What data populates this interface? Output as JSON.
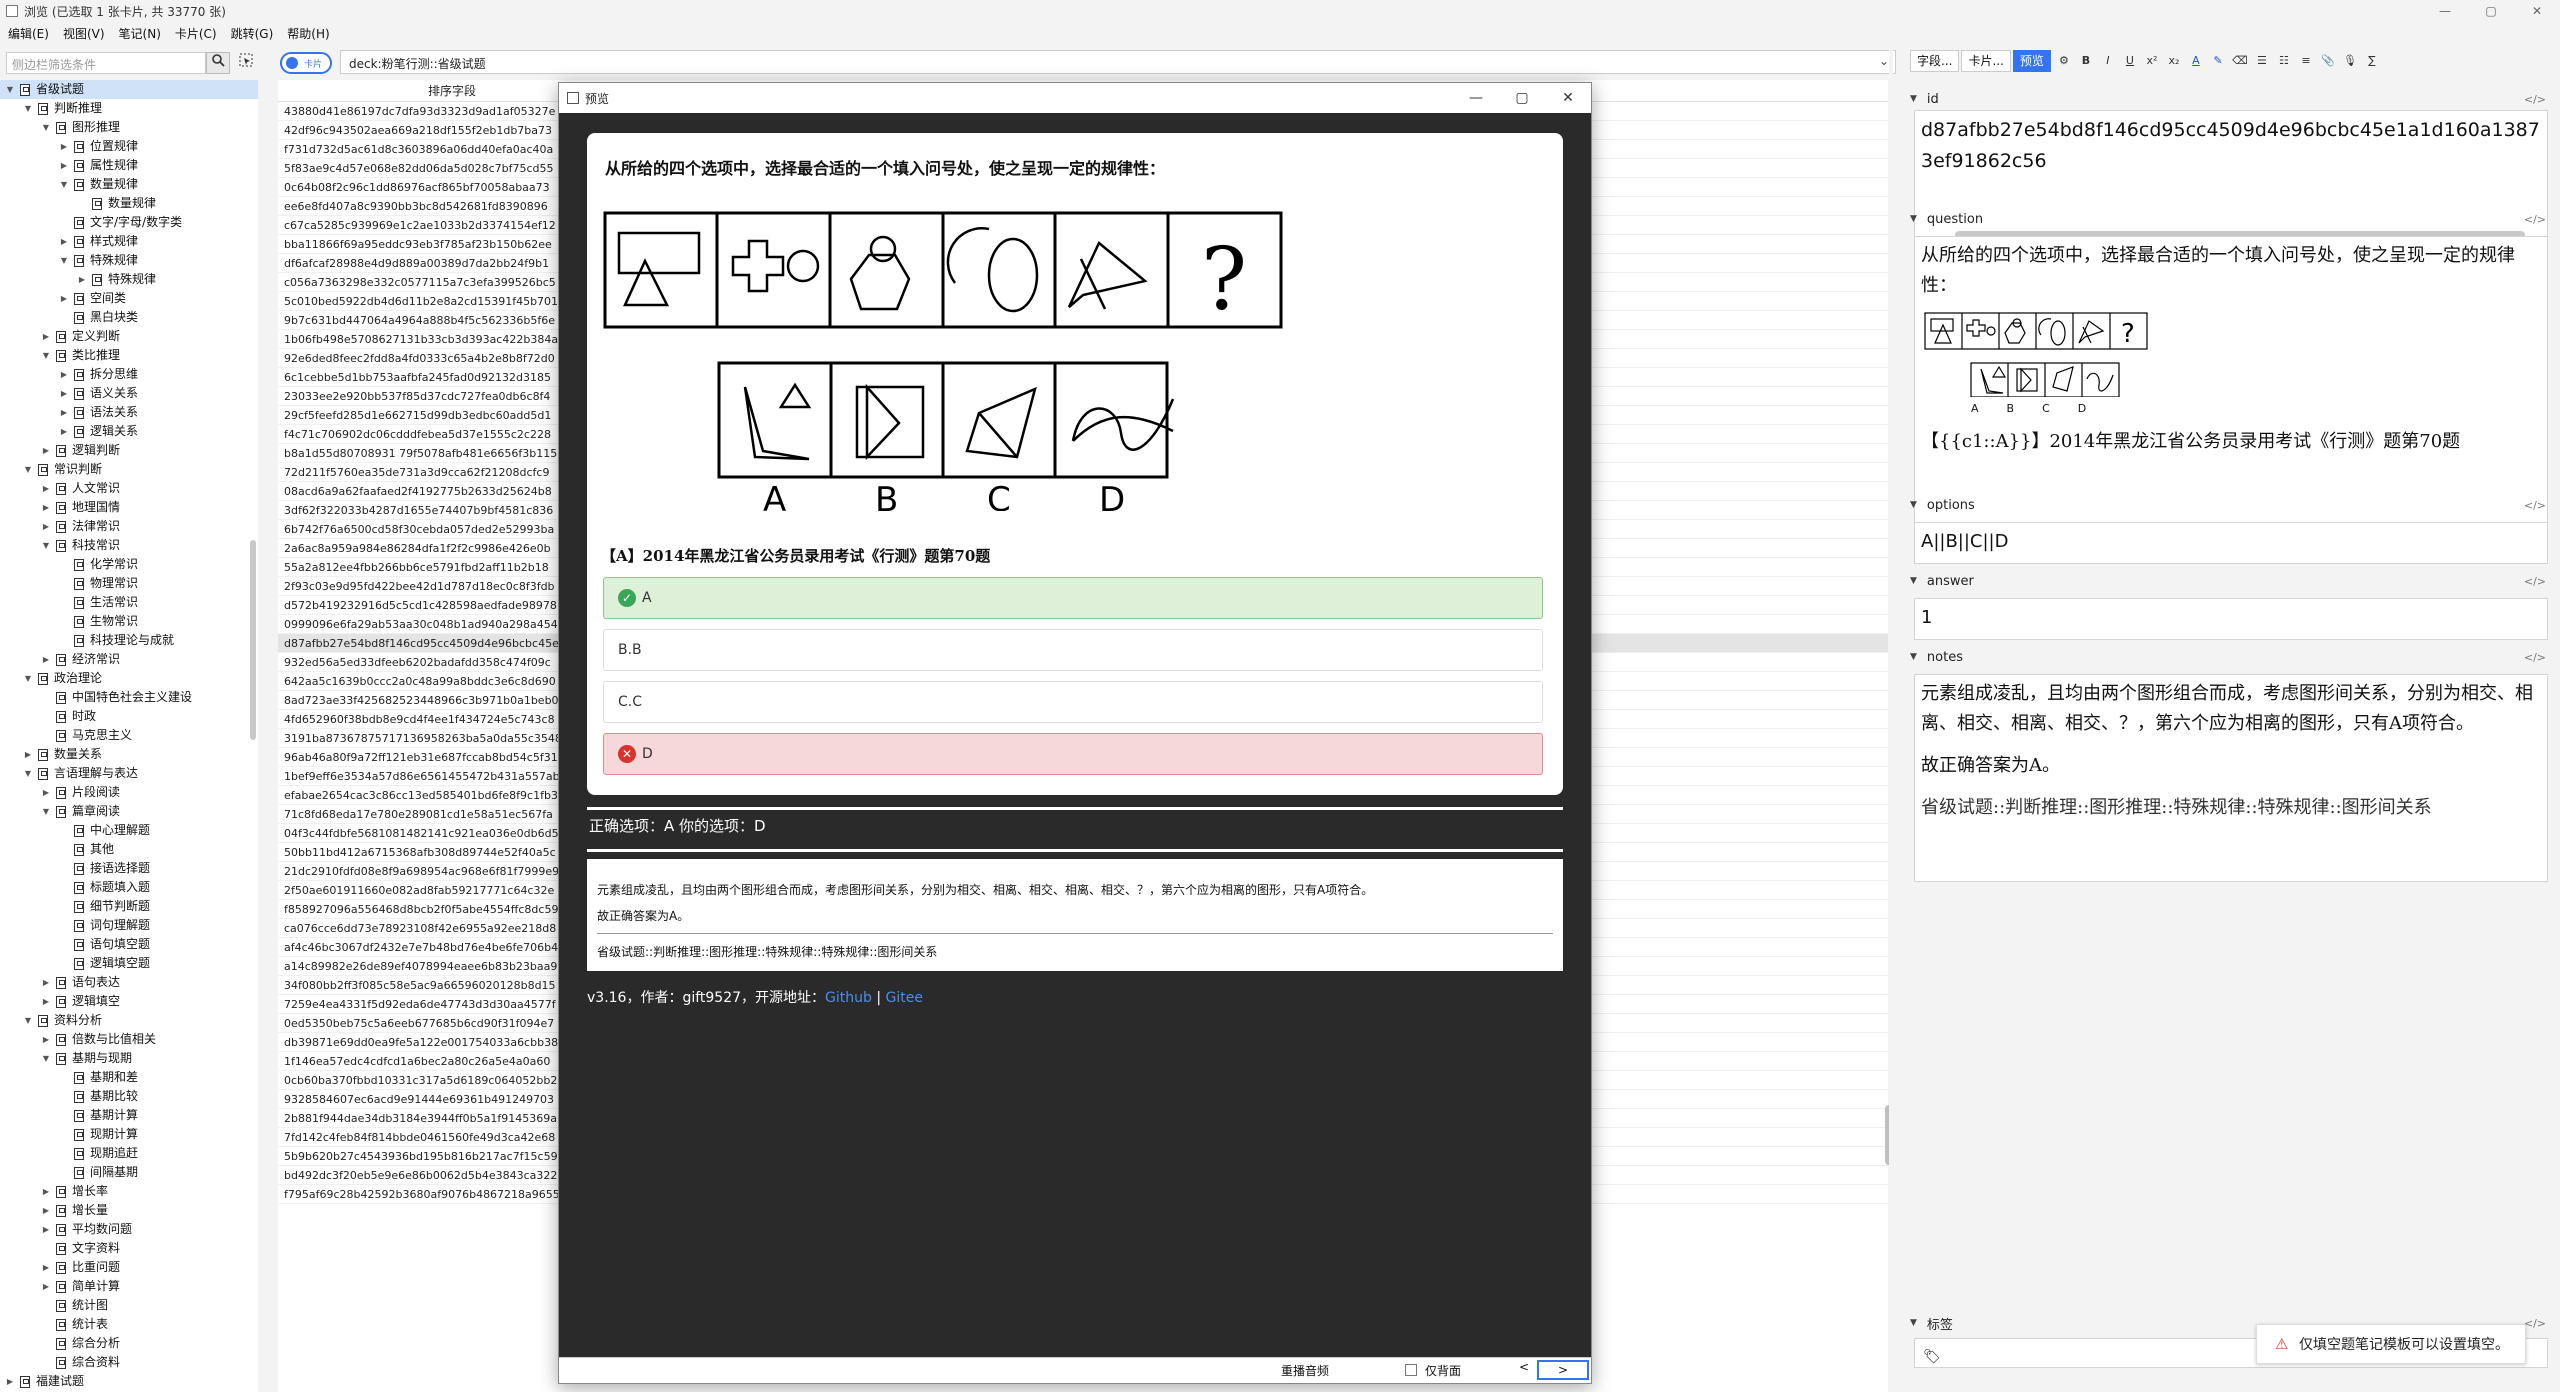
{
  "window": {
    "title": "浏览 (已选取 1 张卡片, 共 33770 张)",
    "controls": [
      "—",
      "▢",
      "✕"
    ]
  },
  "menu": [
    "编辑(E)",
    "视图(V)",
    "笔记(N)",
    "卡片(C)",
    "跳转(G)",
    "帮助(H)"
  ],
  "sidebar": {
    "search_placeholder": "侧边栏筛选条件",
    "tree": [
      {
        "label": "省级试题",
        "lvl": 1,
        "exp": true,
        "sel": true
      },
      {
        "label": "判断推理",
        "lvl": 2,
        "exp": true
      },
      {
        "label": "图形推理",
        "lvl": 3,
        "exp": true
      },
      {
        "label": "位置规律",
        "lvl": 4,
        "exp": false
      },
      {
        "label": "属性规律",
        "lvl": 4,
        "exp": false
      },
      {
        "label": "数量规律",
        "lvl": 4,
        "exp": true
      },
      {
        "label": "数量规律",
        "lvl": 5,
        "exp": null
      },
      {
        "label": "文字/字母/数字类",
        "lvl": 4,
        "exp": null
      },
      {
        "label": "样式规律",
        "lvl": 4,
        "exp": false
      },
      {
        "label": "特殊规律",
        "lvl": 4,
        "exp": true
      },
      {
        "label": "特殊规律",
        "lvl": 5,
        "exp": false
      },
      {
        "label": "空间类",
        "lvl": 4,
        "exp": false
      },
      {
        "label": "黑白块类",
        "lvl": 4,
        "exp": null
      },
      {
        "label": "定义判断",
        "lvl": 3,
        "exp": false
      },
      {
        "label": "类比推理",
        "lvl": 3,
        "exp": true
      },
      {
        "label": "拆分思维",
        "lvl": 4,
        "exp": false
      },
      {
        "label": "语义关系",
        "lvl": 4,
        "exp": false
      },
      {
        "label": "语法关系",
        "lvl": 4,
        "exp": false
      },
      {
        "label": "逻辑关系",
        "lvl": 4,
        "exp": false
      },
      {
        "label": "逻辑判断",
        "lvl": 3,
        "exp": false
      },
      {
        "label": "常识判断",
        "lvl": 2,
        "exp": true
      },
      {
        "label": "人文常识",
        "lvl": 3,
        "exp": false
      },
      {
        "label": "地理国情",
        "lvl": 3,
        "exp": false
      },
      {
        "label": "法律常识",
        "lvl": 3,
        "exp": false
      },
      {
        "label": "科技常识",
        "lvl": 3,
        "exp": true
      },
      {
        "label": "化学常识",
        "lvl": 4,
        "exp": null
      },
      {
        "label": "物理常识",
        "lvl": 4,
        "exp": null
      },
      {
        "label": "生活常识",
        "lvl": 4,
        "exp": null
      },
      {
        "label": "生物常识",
        "lvl": 4,
        "exp": null
      },
      {
        "label": "科技理论与成就",
        "lvl": 4,
        "exp": null
      },
      {
        "label": "经济常识",
        "lvl": 3,
        "exp": false
      },
      {
        "label": "政治理论",
        "lvl": 2,
        "exp": true
      },
      {
        "label": "中国特色社会主义建设",
        "lvl": 3,
        "exp": null
      },
      {
        "label": "时政",
        "lvl": 3,
        "exp": null
      },
      {
        "label": "马克思主义",
        "lvl": 3,
        "exp": null
      },
      {
        "label": "数量关系",
        "lvl": 2,
        "exp": false
      },
      {
        "label": "言语理解与表达",
        "lvl": 2,
        "exp": true
      },
      {
        "label": "片段阅读",
        "lvl": 3,
        "exp": false
      },
      {
        "label": "篇章阅读",
        "lvl": 3,
        "exp": true
      },
      {
        "label": "中心理解题",
        "lvl": 4,
        "exp": null
      },
      {
        "label": "其他",
        "lvl": 4,
        "exp": null
      },
      {
        "label": "接语选择题",
        "lvl": 4,
        "exp": null
      },
      {
        "label": "标题填入题",
        "lvl": 4,
        "exp": null
      },
      {
        "label": "细节判断题",
        "lvl": 4,
        "exp": null
      },
      {
        "label": "词句理解题",
        "lvl": 4,
        "exp": null
      },
      {
        "label": "语句填空题",
        "lvl": 4,
        "exp": null
      },
      {
        "label": "逻辑填空题",
        "lvl": 4,
        "exp": null
      },
      {
        "label": "语句表达",
        "lvl": 3,
        "exp": false
      },
      {
        "label": "逻辑填空",
        "lvl": 3,
        "exp": false
      },
      {
        "label": "资料分析",
        "lvl": 2,
        "exp": true
      },
      {
        "label": "倍数与比值相关",
        "lvl": 3,
        "exp": false
      },
      {
        "label": "基期与现期",
        "lvl": 3,
        "exp": true
      },
      {
        "label": "基期和差",
        "lvl": 4,
        "exp": null
      },
      {
        "label": "基期比较",
        "lvl": 4,
        "exp": null
      },
      {
        "label": "基期计算",
        "lvl": 4,
        "exp": null
      },
      {
        "label": "现期计算",
        "lvl": 4,
        "exp": null
      },
      {
        "label": "现期追赶",
        "lvl": 4,
        "exp": null
      },
      {
        "label": "间隔基期",
        "lvl": 4,
        "exp": null
      },
      {
        "label": "增长率",
        "lvl": 3,
        "exp": false
      },
      {
        "label": "增长量",
        "lvl": 3,
        "exp": false
      },
      {
        "label": "平均数问题",
        "lvl": 3,
        "exp": false
      },
      {
        "label": "文字资料",
        "lvl": 3,
        "exp": null
      },
      {
        "label": "比重问题",
        "lvl": 3,
        "exp": false
      },
      {
        "label": "简单计算",
        "lvl": 3,
        "exp": false
      },
      {
        "label": "统计图",
        "lvl": 3,
        "exp": null
      },
      {
        "label": "统计表",
        "lvl": 3,
        "exp": null
      },
      {
        "label": "综合分析",
        "lvl": 3,
        "exp": null
      },
      {
        "label": "综合资料",
        "lvl": 3,
        "exp": null
      },
      {
        "label": "福建试题",
        "lvl": 1,
        "exp": false
      }
    ]
  },
  "search": {
    "toggle_label": "卡片",
    "query": "deck:粉笔行测::省级试题"
  },
  "cards": {
    "header": "排序字段",
    "rows": [
      "43880d41e86197dc7dfa93d3323d9ad1af05327e",
      "42df96c943502aea669a218df155f2eb1db7ba73",
      "f731d732d5ac61d8c3603896a06dd40efa0ac40a",
      "5f83ae9c4d57e068e82dd06da5d028c7bf75cd55",
      "0c64b08f2c96c1dd86976acf865bf70058abaa73",
      "ee6e8fd407a8c9390bb3bc8d542681fd8390896",
      "c67ca5285c939969e1c2ae1033b2d3374154ef12",
      "bba11866f69a95eddc93eb3f785af23b150b62ee",
      "df6afcaf28988e4d9d889a00389d7da2bb24f9b1",
      "c056a7363298e332c0577115a7c3efa399526bc5",
      "5c010bed5922db4d6d11b2e8a2cd15391f45b701",
      "9b7c631bd447064a4964a888b4f5c562336b5f6e",
      "1b06fb498e5708627131b33cb3d393ac422b384a",
      "92e6ded8feec2fdd8a4fd0333c65a4b2e8b8f72d0",
      "6c1cebbe5d1bb753aafbfa245fad0d92132d3185",
      "23033ee2e920bb537f85d37cdc727fea0db6c8f4",
      "29cf5feefd285d1e662715d99db3edbc60add5d1",
      "f4c71c706902dc06cdddfebea5d37e1555c2c228",
      "b8a1d55d80708931 79f5078afb481e6656f3b115",
      "72d211f5760ea35de731a3d9cca62f21208dcfc9",
      "08acd6a9a62faafaed2f4192775b2633d25624b8",
      "3df62f322033b4287d1655e74407b9bf4581c836",
      "6b742f76a6500cd58f30cebda057ded2e52993ba",
      "2a6ac8a959a984e86284dfa1f2f2c9986e426e0b",
      "55a2a812ee4fbb266bb6ce5791fbd2aff11b2b18",
      "2f93c03e9d95fd422bee42d1d787d18ec0c8f3fdb",
      "d572b419232916d5c5cd1c428598aedfade98978",
      "0999096e6fa29ab53aa30c048b1ad940a298a454",
      "d87afbb27e54bd8f146cd95cc4509d4e96bcbc45e",
      "932ed56a5ed33dfeeb6202badafdd358c474f09c",
      "642aa5c1639b0ccc2a0c48a99a8bddc3e6c8d690",
      "8ad723ae33f425682523448966c3b971b0a1beb0",
      "4fd652960f38bdb8e9cd4f4ee1f434724e5c743c8",
      "3191ba87367875717136958263ba5a0da55c3548",
      "96ab46a80f9a72ff121eb31e687fccab8bd54c5f31",
      "1bef9eff6e3534a57d86e6561455472b431a557ab",
      "efabae2654cac3c86cc13ed585401bd6fe8f9c1fb3",
      "71c8fd68eda17e780e289081cd1e58a51ec567fa",
      "04f3c44fdbfe5681081482141c921ea036e0db6d5",
      "50bb11bd412a6715368afb308d89744e52f40a5c",
      "21dc2910fdfd08e8f9a698954ac968e6f81f7999e9",
      "2f50ae601911660e082ad8fab59217771c64c32e",
      "f858927096a556468d8bcb2f0f5abe4554ffc8dc59",
      "ca076cce6dd73e78923108f42e6955a92ee218d8",
      "af4c46bc3067df2432e7e7b48bd76e4be6fe706b4",
      "a14c89982e26de89ef4078994eaee6b83b23baa9",
      "34f080bb2ff3f085c58e5ac9a66596020128b8d15",
      "7259e4ea4331f5d92eda6de47743d3d30aa4577f",
      "0ed5350beb75c5a6eeb677685b6cd90f31f094e7",
      "db39871e69dd0ea9fe5a122e001754033a6cbb38",
      "1f146ea57edc4cdfcd1a6bec2a80c26a5e4a0a60",
      "0cb60ba370fbbd10331c317a5d6189c064052bb2",
      "9328584607ec6acd9e91444e69361b491249703",
      "2b881f944dae34db3184e3944ff0b5a1f9145369a",
      "7fd142c4feb84f814bbde0461560fe49d3ca42e68",
      "5b9b620b27c4543936bd195b816b217ac7f15c59",
      "bd492dc3f20eb5e9e6e86b0062d5b4e3843ca322",
      "f795af69c28b42592b3680af9076b4867218a9655"
    ],
    "current_index": 28
  },
  "editor": {
    "tabs": [
      "字段...",
      "卡片...",
      "预览"
    ],
    "format_icons": [
      "gear-icon",
      "bold-icon",
      "italic-icon",
      "underline-icon",
      "superscript-icon",
      "subscript-icon",
      "text-color-icon",
      "highlight-icon",
      "eraser-icon",
      "bullet-list-icon",
      "numbered-list-icon",
      "align-icon",
      "attach-icon",
      "record-icon",
      "math-icon"
    ],
    "fields": [
      {
        "name": "id",
        "value": "d87afbb27e54bd8f146cd95cc4509d4e96bcbc45e1a1d160a13873ef91862c56"
      },
      {
        "name": "question",
        "value": "从所给的四个选项中，选择最合适的一个填入问号处，使之呈现一定的规律性：",
        "source": "【{{c1::A}}】2014年黑龙江省公务员录用考试《行测》题第70题"
      },
      {
        "name": "options",
        "value": "A||B||C||D"
      },
      {
        "name": "answer",
        "value": "1"
      },
      {
        "name": "notes",
        "value": "元素组成凌乱，且均由两个图形组合而成，考虑图形间关系，分别为相交、相离、相交、相离、相交、？，第六个应为相离的图形，只有A项符合。",
        "value2": "故正确答案为A。",
        "value3": "省级试题::判断推理::图形推理::特殊规律::特殊规律::图形间关系"
      }
    ],
    "tags_label": "标签",
    "toast": "仅填空题笔记模板可以设置填空。"
  },
  "preview": {
    "title": "预览",
    "question": "从所给的四个选项中，选择最合适的一个填入问号处，使之呈现一定的规律性：",
    "option_letters": [
      "A",
      "B",
      "C",
      "D"
    ],
    "source": "【A】2014年黑龙江省公务员录用考试《行测》题第70题",
    "options": [
      {
        "label": "A",
        "state": "correct"
      },
      {
        "label": "B.B",
        "state": "none"
      },
      {
        "label": "C.C",
        "state": "none"
      },
      {
        "label": "D",
        "state": "wrong"
      }
    ],
    "result": "正确选项：A   你的选项：D",
    "notes_line1": "元素组成凌乱，且均由两个图形组合而成，考虑图形间关系，分别为相交、相离、相交、相离、相交、？，第六个应为相离的图形，只有A项符合。",
    "notes_line2": "故正确答案为A。",
    "notes_tags": "省级试题::判断推理::图形推理::特殊规律::特殊规律::图形间关系",
    "version_prefix": "v3.16，作者：gift9527，开源地址：",
    "link_github": "Github",
    "link_sep": " | ",
    "link_gitee": "Gitee",
    "replay": "重播音频",
    "back_only": "仅背面",
    "prev": "<",
    "next": ">"
  }
}
